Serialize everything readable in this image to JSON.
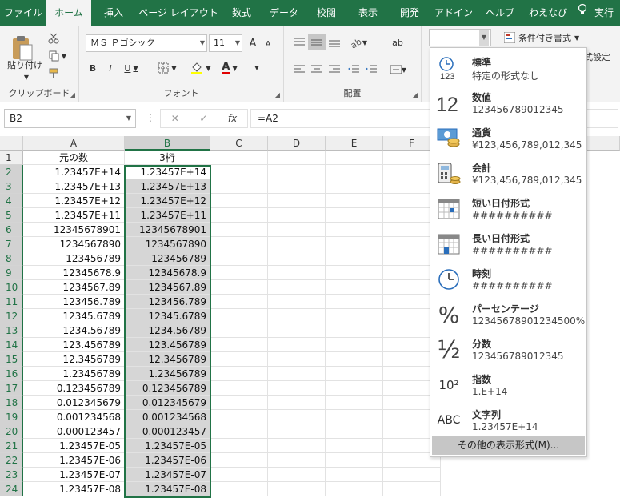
{
  "tabs": [
    "ファイル",
    "ホーム",
    "挿入",
    "ページ レイアウト",
    "数式",
    "データ",
    "校閲",
    "表示",
    "開発",
    "アドイン",
    "ヘルプ",
    "わえなび",
    "実行"
  ],
  "ribbon": {
    "clipboard": {
      "paste": "貼り付け",
      "label": "クリップボード"
    },
    "font": {
      "name": "ＭＳ Ｐゴシック",
      "size": "11",
      "bold": "B",
      "italic": "I",
      "underline": "U",
      "label": "フォント",
      "font_color_glyph": "A",
      "grow": "A",
      "shrink": "A",
      "wrap_glyph": "ab"
    },
    "align": {
      "label": "配置"
    },
    "number_format_value": "",
    "conditional": "条件付き書式",
    "table_style": "式設定"
  },
  "formula_bar": {
    "name_box": "B2",
    "fx": "fx",
    "formula": "=A2"
  },
  "columns": [
    "A",
    "B",
    "C",
    "D",
    "E",
    "F"
  ],
  "rows": [
    {
      "n": "1",
      "a": "元の数",
      "b": "3桁"
    },
    {
      "n": "2",
      "a": "1.23457E+14",
      "b": "1.23457E+14"
    },
    {
      "n": "3",
      "a": "1.23457E+13",
      "b": "1.23457E+13"
    },
    {
      "n": "4",
      "a": "1.23457E+12",
      "b": "1.23457E+12"
    },
    {
      "n": "5",
      "a": "1.23457E+11",
      "b": "1.23457E+11"
    },
    {
      "n": "6",
      "a": "12345678901",
      "b": "12345678901"
    },
    {
      "n": "7",
      "a": "1234567890",
      "b": "1234567890"
    },
    {
      "n": "8",
      "a": "123456789",
      "b": "123456789"
    },
    {
      "n": "9",
      "a": "12345678.9",
      "b": "12345678.9"
    },
    {
      "n": "10",
      "a": "1234567.89",
      "b": "1234567.89"
    },
    {
      "n": "11",
      "a": "123456.789",
      "b": "123456.789"
    },
    {
      "n": "12",
      "a": "12345.6789",
      "b": "12345.6789"
    },
    {
      "n": "13",
      "a": "1234.56789",
      "b": "1234.56789"
    },
    {
      "n": "14",
      "a": "123.456789",
      "b": "123.456789"
    },
    {
      "n": "15",
      "a": "12.3456789",
      "b": "12.3456789"
    },
    {
      "n": "16",
      "a": "1.23456789",
      "b": "1.23456789"
    },
    {
      "n": "17",
      "a": "0.123456789",
      "b": "0.123456789"
    },
    {
      "n": "18",
      "a": "0.012345679",
      "b": "0.012345679"
    },
    {
      "n": "19",
      "a": "0.001234568",
      "b": "0.001234568"
    },
    {
      "n": "20",
      "a": "0.000123457",
      "b": "0.000123457"
    },
    {
      "n": "21",
      "a": "1.23457E-05",
      "b": "1.23457E-05"
    },
    {
      "n": "22",
      "a": "1.23457E-06",
      "b": "1.23457E-06"
    },
    {
      "n": "23",
      "a": "1.23457E-07",
      "b": "1.23457E-07"
    },
    {
      "n": "24",
      "a": "1.23457E-08",
      "b": "1.23457E-08"
    }
  ],
  "dropdown": {
    "items": [
      {
        "name": "標準",
        "example": "特定の形式なし",
        "icon": "clock-123-icon",
        "glyph": "123"
      },
      {
        "name": "数値",
        "example": "123456789012345",
        "icon": "number-12-icon",
        "glyph": "12"
      },
      {
        "name": "通貨",
        "example": "¥123,456,789,012,345",
        "icon": "currency-icon",
        "glyph": ""
      },
      {
        "name": "会計",
        "example": " ¥123,456,789,012,345",
        "icon": "accounting-icon",
        "glyph": ""
      },
      {
        "name": "短い日付形式",
        "example": "##########",
        "icon": "short-date-icon",
        "glyph": ""
      },
      {
        "name": "長い日付形式",
        "example": "##########",
        "icon": "long-date-icon",
        "glyph": ""
      },
      {
        "name": "時刻",
        "example": "##########",
        "icon": "clock-icon",
        "glyph": ""
      },
      {
        "name": "パーセンテージ",
        "example": "12345678901234500%",
        "icon": "percent-icon",
        "glyph": "%"
      },
      {
        "name": "分数",
        "example": "123456789012345",
        "icon": "fraction-icon",
        "glyph": "½"
      },
      {
        "name": "指数",
        "example": "1.E+14",
        "icon": "exponent-icon",
        "glyph": "10²"
      },
      {
        "name": "文字列",
        "example": "1.23457E+14",
        "icon": "text-abc-icon",
        "glyph": "ABC"
      }
    ],
    "more": "その他の表示形式(M)..."
  },
  "colors": {
    "accent": "#217346",
    "selection": "#d6d6d6"
  }
}
